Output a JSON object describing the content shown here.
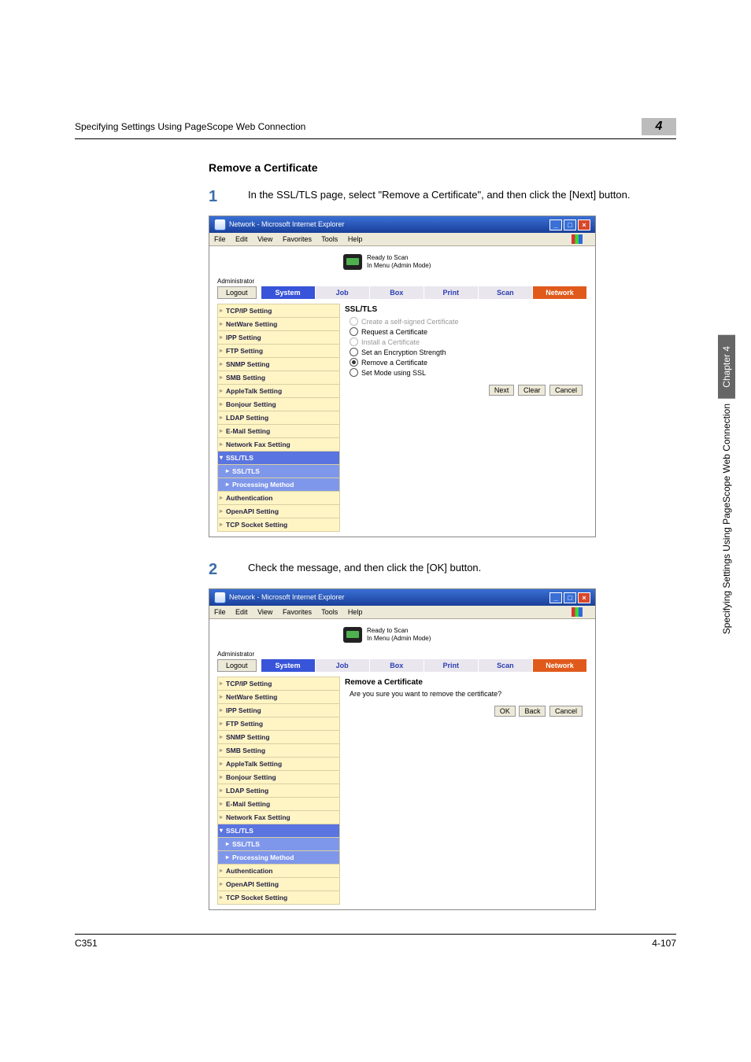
{
  "header": {
    "running": "Specifying Settings Using PageScope Web Connection",
    "chapnum": "4"
  },
  "section": {
    "title": "Remove a Certificate"
  },
  "steps": {
    "1": {
      "num": "1",
      "text": "In the SSL/TLS page, select \"Remove a Certificate\", and then click the [Next] button."
    },
    "2": {
      "num": "2",
      "text": "Check the message, and then click the [OK] button."
    }
  },
  "ie": {
    "title": "Network - Microsoft Internet Explorer",
    "menu": {
      "file": "File",
      "edit": "Edit",
      "view": "View",
      "favorites": "Favorites",
      "tools": "Tools",
      "help": "Help"
    }
  },
  "app": {
    "status1": "Ready to Scan",
    "status2": "In Menu (Admin Mode)",
    "admin": "Administrator",
    "logout": "Logout",
    "tabs": {
      "system": "System",
      "job": "Job",
      "box": "Box",
      "print": "Print",
      "scan": "Scan",
      "network": "Network"
    },
    "side": {
      "tcpip": "TCP/IP Setting",
      "netware": "NetWare Setting",
      "ipp": "IPP Setting",
      "ftp": "FTP Setting",
      "snmp": "SNMP Setting",
      "smb": "SMB Setting",
      "appletalk": "AppleTalk Setting",
      "bonjour": "Bonjour Setting",
      "ldap": "LDAP Setting",
      "email": "E-Mail Setting",
      "netfax": "Network Fax Setting",
      "ssltls": "SSL/TLS",
      "ssltls_sub": "SSL/TLS",
      "procmethod": "Processing Method",
      "auth": "Authentication",
      "openapi": "OpenAPI Setting",
      "tcpsocket": "TCP Socket Setting"
    }
  },
  "panel1": {
    "title": "SSL/TLS",
    "opts": {
      "create": "Create a self-signed Certificate",
      "request": "Request a Certificate",
      "install": "Install a Certificate",
      "encstr": "Set an Encryption Strength",
      "remove": "Remove a Certificate",
      "setmode": "Set Mode using SSL"
    },
    "buttons": {
      "next": "Next",
      "clear": "Clear",
      "cancel": "Cancel"
    }
  },
  "panel2": {
    "title": "Remove a Certificate",
    "msg": "Are you sure you want to remove the certificate?",
    "buttons": {
      "ok": "OK",
      "back": "Back",
      "cancel": "Cancel"
    }
  },
  "vside": {
    "chapter": "Chapter 4",
    "label": "Specifying Settings Using PageScope Web Connection"
  },
  "footer": {
    "model": "C351",
    "page": "4-107"
  }
}
